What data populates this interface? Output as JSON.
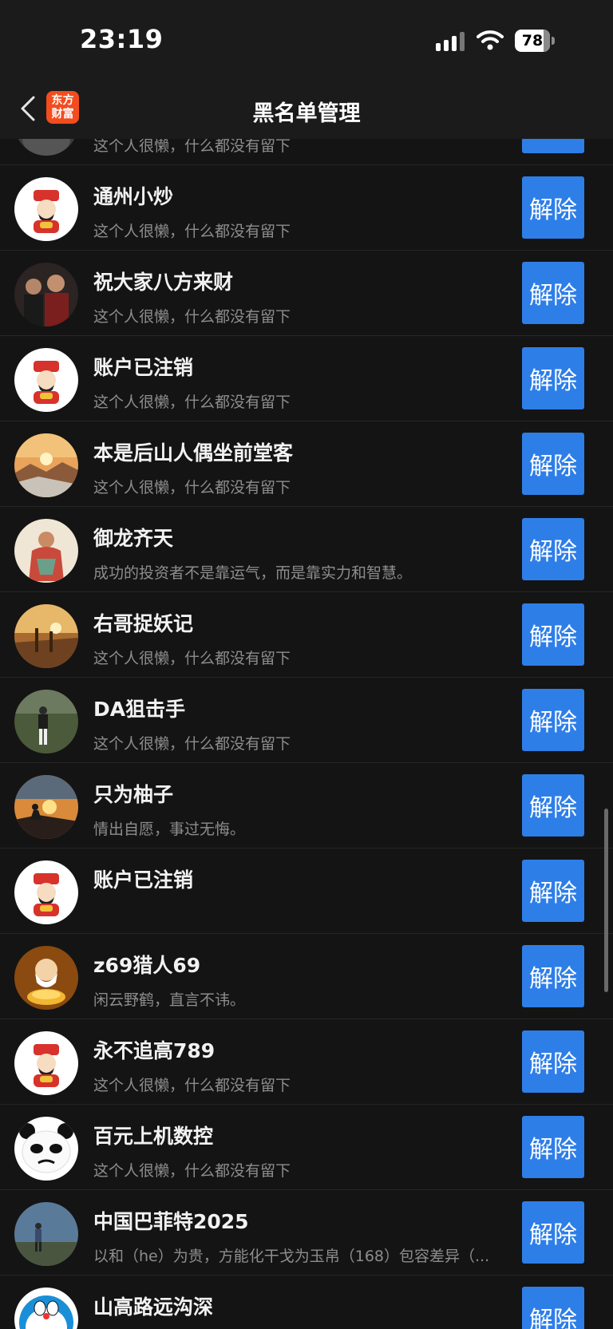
{
  "status_bar": {
    "time": "23:19",
    "battery": "78"
  },
  "header": {
    "title": "黑名单管理",
    "logo_line1": "东方",
    "logo_line2": "财富"
  },
  "list": {
    "unblock_label": "解除",
    "items": [
      {
        "name": "",
        "bio": "这个人很懒，什么都没有留下",
        "avatar": "dark-photo-avatar"
      },
      {
        "name": "通州小炒",
        "bio": "这个人很懒，什么都没有留下",
        "avatar": "fortune-god-avatar"
      },
      {
        "name": "祝大家八方来财",
        "bio": "这个人很懒，什么都没有留下",
        "avatar": "people-photo-avatar"
      },
      {
        "name": "账户已注销",
        "bio": "这个人很懒，什么都没有留下",
        "avatar": "fortune-god-avatar"
      },
      {
        "name": "本是后山人偶坐前堂客",
        "bio": "这个人很懒，什么都没有留下",
        "avatar": "sunset-landscape-avatar"
      },
      {
        "name": "御龙齐天",
        "bio": "成功的投资者不是靠运气，而是靠实力和智慧。",
        "avatar": "painting-avatar"
      },
      {
        "name": "右哥捉妖记",
        "bio": "这个人很懒，什么都没有留下",
        "avatar": "golden-field-avatar"
      },
      {
        "name": "DA狙击手",
        "bio": "这个人很懒，什么都没有留下",
        "avatar": "man-in-field-avatar"
      },
      {
        "name": "只为柚子",
        "bio": "情出自愿，事过无悔。",
        "avatar": "sunset-silhouette-avatar"
      },
      {
        "name": "账户已注销",
        "bio": "",
        "avatar": "fortune-god-avatar"
      },
      {
        "name": "z69猎人69",
        "bio": "闲云野鹤，直言不讳。",
        "avatar": "gold-wealth-god-avatar"
      },
      {
        "name": "永不追高789",
        "bio": "这个人很懒，什么都没有留下",
        "avatar": "fortune-god-avatar"
      },
      {
        "name": "百元上机数控",
        "bio": "这个人很懒，什么都没有留下",
        "avatar": "panda-meme-avatar"
      },
      {
        "name": "中国巴菲特2025",
        "bio": "以和（he）为贵，方能化干戈为玉帛（168）包容差异（...",
        "avatar": "hiker-photo-avatar"
      },
      {
        "name": "山高路远沟深",
        "bio": "",
        "avatar": "doraemon-avatar"
      }
    ]
  }
}
